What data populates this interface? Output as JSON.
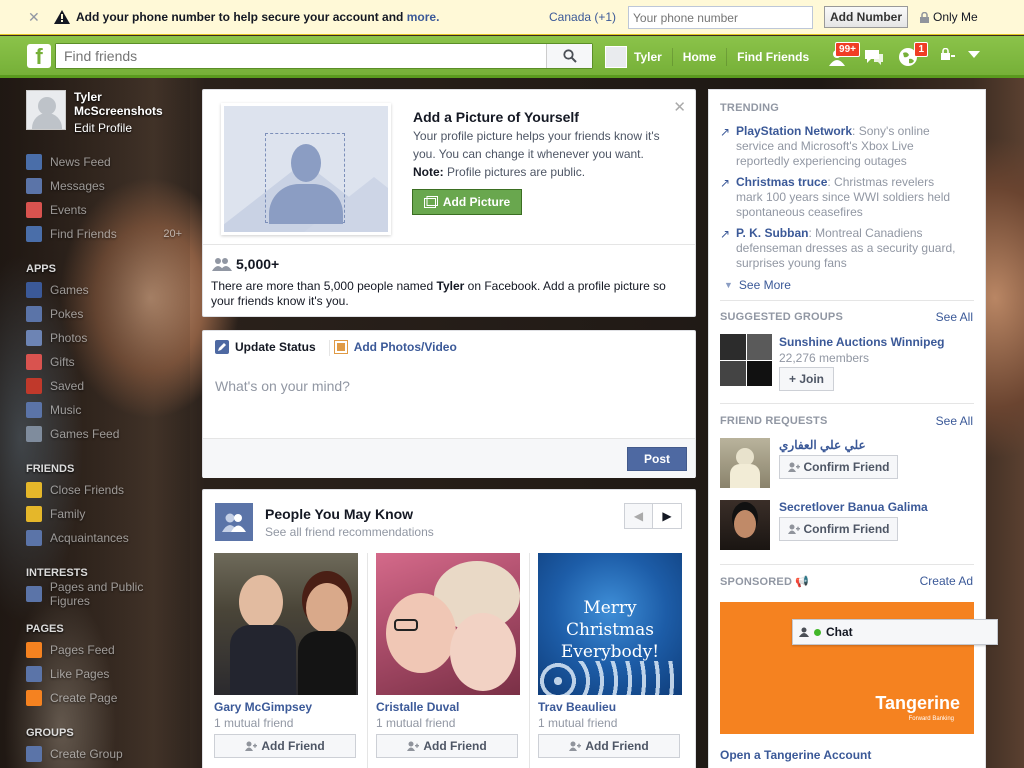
{
  "phone_banner": {
    "message": "Add your phone number to help secure your account and",
    "more_link": "more.",
    "country": "Canada (+1)",
    "phone_placeholder": "Your phone number",
    "add_button": "Add Number",
    "privacy": "Only Me"
  },
  "topbar": {
    "logo": "f",
    "search_placeholder": "Find friends",
    "user_name": "Tyler",
    "home": "Home",
    "find_friends": "Find Friends",
    "friend_requests_badge": "99+",
    "notifications_badge": "1"
  },
  "profile": {
    "name_line1": "Tyler",
    "name_line2": "McScreenshots",
    "edit": "Edit Profile"
  },
  "sidebar": {
    "favorites": [
      {
        "label": "News Feed",
        "icon": "news-feed-icon",
        "color": "#4a6ea9"
      },
      {
        "label": "Messages",
        "icon": "messages-icon",
        "color": "#5b74a8"
      },
      {
        "label": "Events",
        "icon": "events-icon",
        "color": "#d9534f"
      },
      {
        "label": "Find Friends",
        "icon": "find-friends-icon",
        "color": "#4a6ea9",
        "count": "20+"
      }
    ],
    "apps_header": "APPS",
    "apps": [
      {
        "label": "Games",
        "icon": "games-icon",
        "color": "#3b5998"
      },
      {
        "label": "Pokes",
        "icon": "pokes-icon",
        "color": "#5b74a8"
      },
      {
        "label": "Photos",
        "icon": "photos-icon",
        "color": "#6d84b4"
      },
      {
        "label": "Gifts",
        "icon": "gifts-icon",
        "color": "#d9534f"
      },
      {
        "label": "Saved",
        "icon": "saved-icon",
        "color": "#c0392b"
      },
      {
        "label": "Music",
        "icon": "music-icon",
        "color": "#5b74a8"
      },
      {
        "label": "Games Feed",
        "icon": "games-feed-icon",
        "color": "#7f8c9d"
      }
    ],
    "friends_header": "FRIENDS",
    "friends": [
      {
        "label": "Close Friends",
        "icon": "close-friends-icon",
        "color": "#e5b72a"
      },
      {
        "label": "Family",
        "icon": "family-icon",
        "color": "#e5b72a"
      },
      {
        "label": "Acquaintances",
        "icon": "acquaintances-icon",
        "color": "#5b74a8"
      }
    ],
    "interests_header": "INTERESTS",
    "interests": [
      {
        "label": "Pages and Public Figures",
        "icon": "pages-feed-icon",
        "color": "#5b74a8"
      }
    ],
    "pages_header": "PAGES",
    "pages": [
      {
        "label": "Pages Feed",
        "icon": "pages-feed-icon",
        "color": "#f58220"
      },
      {
        "label": "Like Pages",
        "icon": "like-pages-icon",
        "color": "#5b74a8"
      },
      {
        "label": "Create Page",
        "icon": "create-page-icon",
        "color": "#f58220"
      }
    ],
    "groups_header": "GROUPS",
    "groups": [
      {
        "label": "Create Group",
        "icon": "create-group-icon",
        "color": "#5b74a8"
      }
    ]
  },
  "add_picture": {
    "title": "Add a Picture of Yourself",
    "desc": "Your profile picture helps your friends know it's you. You can change it whenever you want.",
    "note_label": "Note:",
    "note": "Profile pictures are public.",
    "button": "Add Picture",
    "count": "5,000+",
    "count_desc_1": "There are more than 5,000 people named",
    "count_desc_name": "Tyler",
    "count_desc_2": "on Facebook. Add a profile picture so your friends know it's you."
  },
  "composer": {
    "tab_status": "Update Status",
    "tab_photos": "Add Photos/Video",
    "placeholder": "What's on your mind?",
    "post": "Post"
  },
  "pymk": {
    "title": "People You May Know",
    "subtitle": "See all friend recommendations",
    "people": [
      {
        "name": "Gary McGimpsey",
        "mutual": "1 mutual friend",
        "button": "Add Friend"
      },
      {
        "name": "Cristalle Duval",
        "mutual": "1 mutual friend",
        "button": "Add Friend"
      },
      {
        "name": "Trav Beaulieu",
        "mutual": "1 mutual friend",
        "button": "Add Friend"
      }
    ],
    "xmas_text_1": "Merry Christmas",
    "xmas_text_2": "Everybody!"
  },
  "trending": {
    "header": "TRENDING",
    "items": [
      {
        "topic": "PlayStation Network",
        "text": ": Sony's online service and Microsoft's Xbox Live reportedly experiencing outages"
      },
      {
        "topic": "Christmas truce",
        "text": ": Christmas revelers mark 100 years since WWI soldiers held spontaneous ceasefires"
      },
      {
        "topic": "P. K. Subban",
        "text": ": Montreal Canadiens defenseman dresses as a security guard, surprises young fans"
      }
    ],
    "see_more": "See More"
  },
  "suggested_groups": {
    "header": "SUGGESTED GROUPS",
    "see_all": "See All",
    "name": "Sunshine Auctions Winnipeg",
    "members": "22,276 members",
    "join": "Join"
  },
  "friend_requests": {
    "header": "FRIEND REQUESTS",
    "see_all": "See All",
    "items": [
      {
        "name": "علي علي العفاري",
        "button": "Confirm Friend"
      },
      {
        "name": "Secretlover Banua Galima",
        "button": "Confirm Friend"
      }
    ]
  },
  "sponsored": {
    "header": "SPONSORED",
    "create_ad": "Create Ad",
    "brand": "Tangerine",
    "brand_tag": "Forward Banking",
    "title": "Open a Tangerine Account"
  },
  "chat": {
    "label": "Chat"
  }
}
